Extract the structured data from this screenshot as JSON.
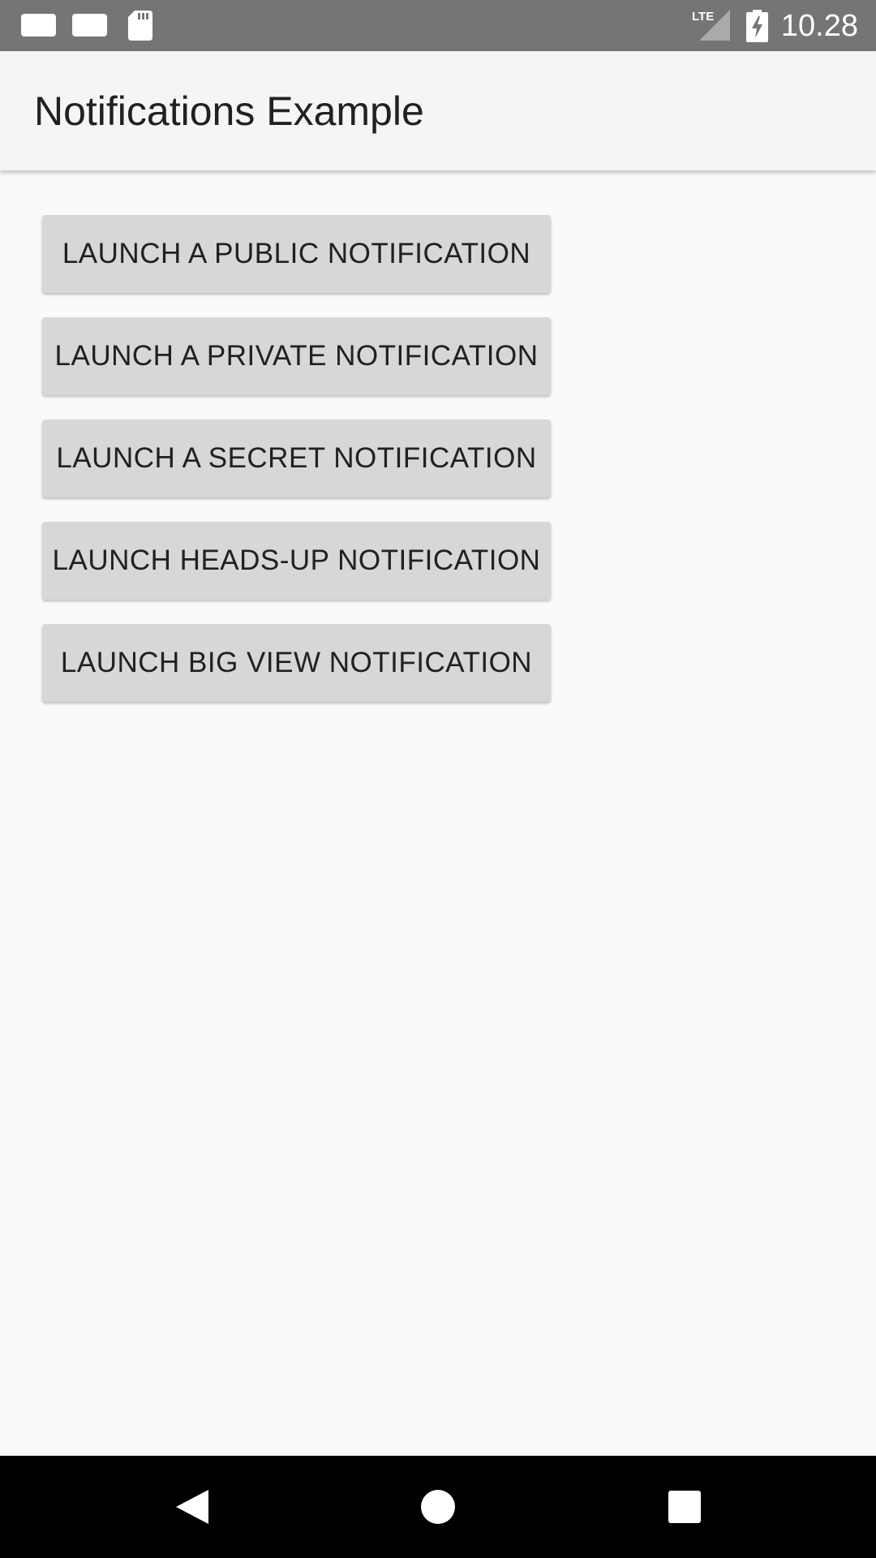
{
  "status_bar": {
    "time": "10.28",
    "network": "LTE",
    "icons": [
      "notification-icon",
      "notification-icon",
      "sd-card-icon",
      "lte-signal-icon",
      "battery-charging-icon"
    ]
  },
  "app_bar": {
    "title": "Notifications Example"
  },
  "buttons": [
    {
      "label": "LAUNCH A PUBLIC NOTIFICATION"
    },
    {
      "label": "LAUNCH A PRIVATE NOTIFICATION"
    },
    {
      "label": "LAUNCH A SECRET NOTIFICATION"
    },
    {
      "label": "LAUNCH HEADS-UP NOTIFICATION"
    },
    {
      "label": "LAUNCH BIG VIEW NOTIFICATION"
    }
  ],
  "nav_bar": {
    "icons": [
      "back-icon",
      "home-icon",
      "recents-icon"
    ]
  },
  "colors": {
    "status_bar": "#757575",
    "app_bar": "#f5f5f5",
    "background": "#fafafa",
    "button": "#d6d7d7",
    "text": "#212121",
    "nav_bar": "#000000"
  }
}
